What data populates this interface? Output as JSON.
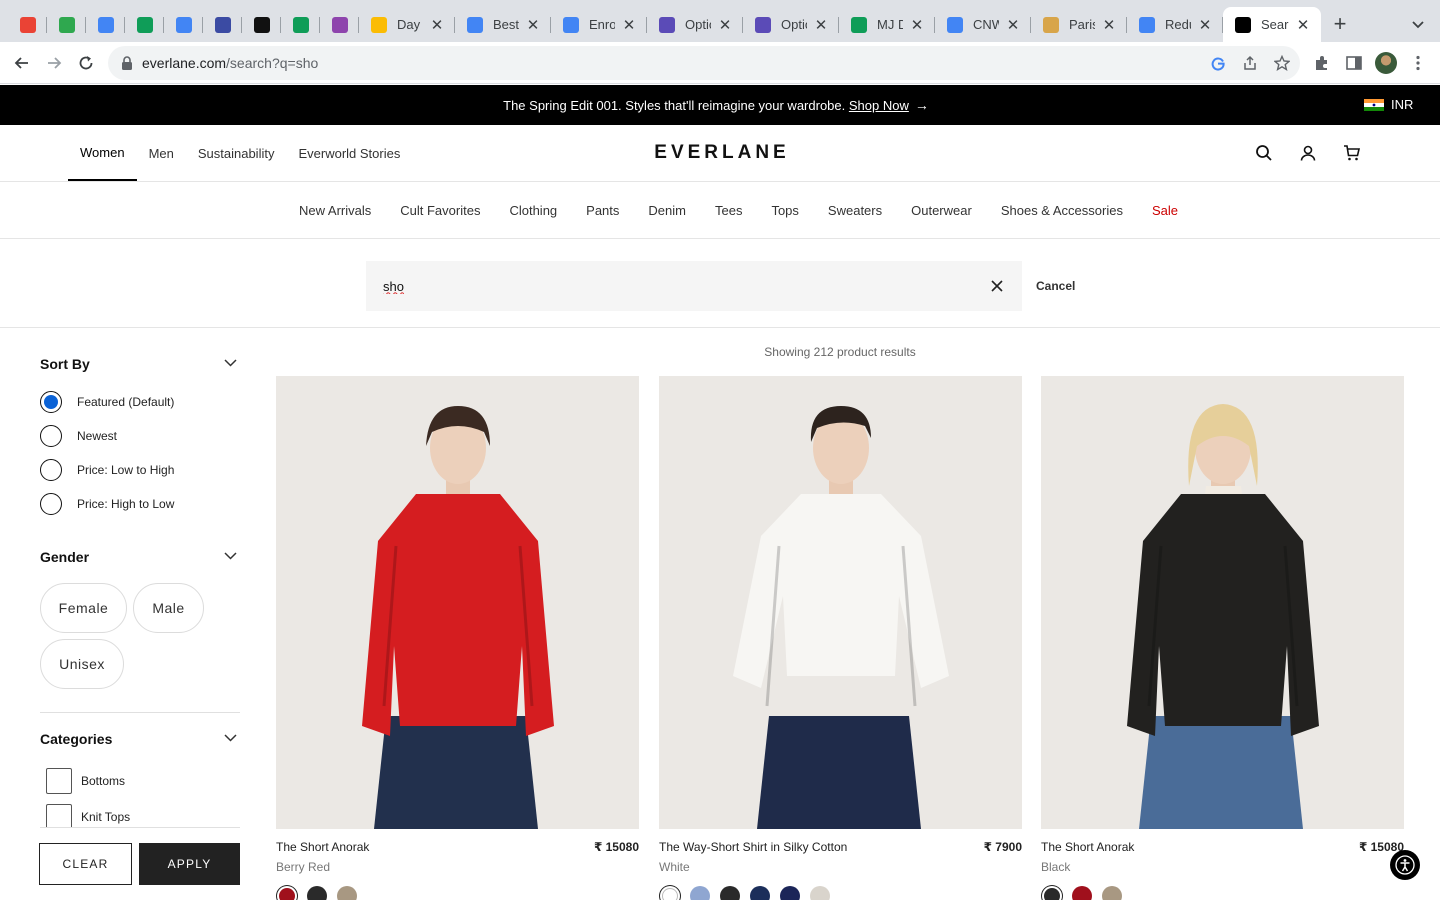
{
  "browser": {
    "tabs": [
      {
        "title": "",
        "favicon": "gmail-icon",
        "color": "#ea4335"
      },
      {
        "title": "",
        "favicon": "badge-icon",
        "color": "#2fa84f"
      },
      {
        "title": "",
        "favicon": "docs-icon",
        "color": "#4285f4"
      },
      {
        "title": "",
        "favicon": "sheets-icon",
        "color": "#0f9d58"
      },
      {
        "title": "",
        "favicon": "docs-icon",
        "color": "#4285f4"
      },
      {
        "title": "",
        "favicon": "app-icon",
        "color": "#3b4ba3"
      },
      {
        "title": "",
        "favicon": "openai-icon",
        "color": "#111111"
      },
      {
        "title": "",
        "favicon": "sheets-icon",
        "color": "#0f9d58"
      },
      {
        "title": "",
        "favicon": "chat-icon",
        "color": "#8e44ad"
      },
      {
        "title": "Day -",
        "favicon": "ads-icon",
        "color": "#fbbc04"
      },
      {
        "title": "Best F",
        "favicon": "docs-icon",
        "color": "#4285f4"
      },
      {
        "title": "Enroll",
        "favicon": "google-icon",
        "color": "#4285f4"
      },
      {
        "title": "Optio",
        "favicon": "app-icon",
        "color": "#5b4bb7"
      },
      {
        "title": "Optio",
        "favicon": "app-icon",
        "color": "#5b4bb7"
      },
      {
        "title": "MJ Da",
        "favicon": "sheets-icon",
        "color": "#0f9d58"
      },
      {
        "title": "CNW",
        "favicon": "docs-icon",
        "color": "#4285f4"
      },
      {
        "title": "Paris",
        "favicon": "tower-icon",
        "color": "#d8a54a"
      },
      {
        "title": "Redu",
        "favicon": "docs-icon",
        "color": "#4285f4"
      },
      {
        "title": "Searc",
        "favicon": "everlane-icon",
        "color": "#000000",
        "active": true
      }
    ],
    "url_host": "everlane.com",
    "url_path": "/search?q=sho"
  },
  "promo": {
    "message": "The Spring Edit 001. Styles that'll reimagine your wardrobe.",
    "link": "Shop Now",
    "currency": "INR"
  },
  "header": {
    "nav": [
      "Women",
      "Men",
      "Sustainability",
      "Everworld Stories"
    ],
    "logo": "EVERLANE"
  },
  "categories": [
    "New Arrivals",
    "Cult Favorites",
    "Clothing",
    "Pants",
    "Denim",
    "Tees",
    "Tops",
    "Sweaters",
    "Outerwear",
    "Shoes & Accessories",
    "Sale"
  ],
  "search": {
    "value": "sho",
    "cancel": "Cancel"
  },
  "filters": {
    "sort_title": "Sort By",
    "sort_options": [
      "Featured (Default)",
      "Newest",
      "Price: Low to High",
      "Price: High to Low"
    ],
    "sort_selected": "Featured (Default)",
    "gender_title": "Gender",
    "genders": [
      "Female",
      "Male",
      "Unisex"
    ],
    "categories_title": "Categories",
    "category_options": [
      "Bottoms",
      "Knit Tops"
    ],
    "clear": "CLEAR",
    "apply": "APPLY"
  },
  "results": {
    "summary": "Showing 212 product results",
    "products": [
      {
        "name": "The Short Anorak",
        "price": "₹ 15080",
        "color": "Berry Red",
        "swatches": [
          "#a0101c",
          "#2a2a2a",
          "#a89882"
        ]
      },
      {
        "name": "The Way-Short Shirt in Silky Cotton",
        "price": "₹ 7900",
        "color": "White",
        "swatches": [
          "#ffffff",
          "#8fa6d1",
          "#2a2a2a",
          "#1b2e5a",
          "#1b2558",
          "#d9d4cc"
        ]
      },
      {
        "name": "The Short Anorak",
        "price": "₹ 15080",
        "color": "Black",
        "swatches": [
          "#2a2a2a",
          "#a0101c",
          "#a89882"
        ]
      }
    ]
  },
  "colors": {
    "accent_radio": "#0a62d6",
    "sale": "#cc0000",
    "promo_bg": "#000000"
  }
}
